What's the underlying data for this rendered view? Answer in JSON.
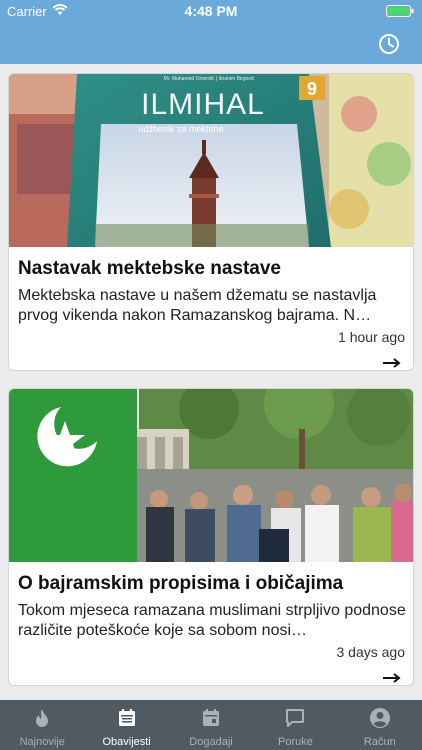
{
  "status_bar": {
    "carrier": "Carrier",
    "time": "4:48 PM"
  },
  "header": {
    "action_icon": "clock-icon"
  },
  "articles": [
    {
      "title": "Nastavak mektebske nastave",
      "excerpt": "Mektebska nastave u našem džematu se nastavlja prvog vikenda nakon Ramazanskog bajrama. N…",
      "time": "1 hour ago",
      "image_book_title": "ILMIHAL",
      "image_book_subtitle": "udžbenik za mektebe",
      "image_book_number": "9",
      "image_book_authors": "Mr. Muhamed Omerdić | Ibrahim Begović"
    },
    {
      "title": "O bajramskim propisima i običajima",
      "excerpt": "Tokom mjeseca ramazana muslimani strpljivo podnose različite poteškoće koje sa sobom nosi…",
      "time": "3 days ago"
    }
  ],
  "tabs": [
    {
      "label": "Najnovije",
      "icon": "flame-icon",
      "active": false
    },
    {
      "label": "Obavijesti",
      "icon": "calendar-list-icon",
      "active": true
    },
    {
      "label": "Dogadaji",
      "icon": "calendar-icon",
      "active": false
    },
    {
      "label": "Poruke",
      "icon": "chat-bubble-icon",
      "active": false
    },
    {
      "label": "Račun",
      "icon": "account-icon",
      "active": false
    }
  ],
  "colors": {
    "header": "#6aa9d9",
    "tabbar": "#4f5a63",
    "battery": "#4cd964"
  }
}
